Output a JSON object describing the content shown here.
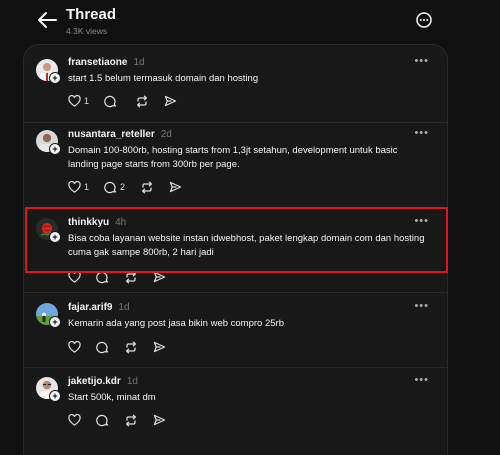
{
  "header": {
    "title": "Thread",
    "views": "4.3K views"
  },
  "posts": [
    {
      "username": "fransetiaone",
      "time": "1d",
      "text": "start 1.5 belum termasuk domain dan hosting",
      "likes": "1",
      "replies": ""
    },
    {
      "username": "nusantara_reteller",
      "time": "2d",
      "text": "Domain 100-800rb, hosting starts from 1,3jt setahun, development untuk basic landing page starts from 300rb per page.",
      "likes": "1",
      "replies": "2"
    },
    {
      "username": "thinkkyu",
      "time": "4h",
      "text": "Bisa coba layanan website instan idwebhost, paket lengkap domain com dan hosting cuma gak sampe 800rb, 2 hari jadi",
      "likes": "",
      "replies": ""
    },
    {
      "username": "fajar.arif9",
      "time": "1d",
      "text": "Kemarin ada yang post jasa bikin web compro 25rb",
      "likes": "",
      "replies": ""
    },
    {
      "username": "jaketijo.kdr",
      "time": "1d",
      "text": "Start 500k, minat dm",
      "likes": "",
      "replies": ""
    }
  ],
  "icons": {
    "back": "arrow-left-icon",
    "more": "more-circle-icon",
    "like": "heart-icon",
    "reply": "comment-icon",
    "repost": "repost-icon",
    "share": "send-icon"
  },
  "colors": {
    "background": "#101010",
    "panel": "#181818",
    "highlight": "#e0161e"
  }
}
